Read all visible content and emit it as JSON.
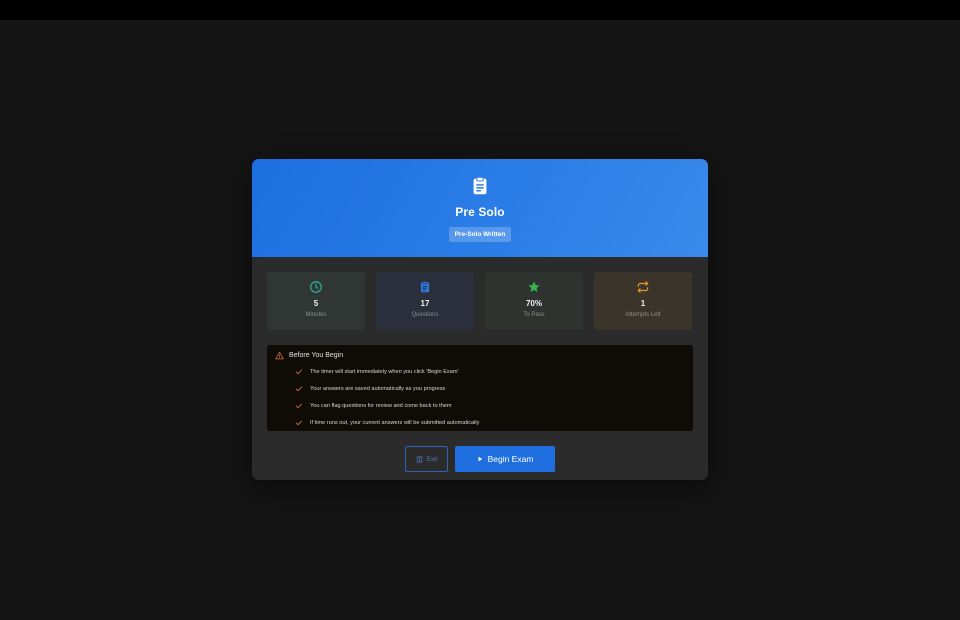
{
  "exam": {
    "title": "Pre Solo",
    "badge": "Pre-Solo Written",
    "icon": "clipboard-icon"
  },
  "stats": [
    {
      "value": "5",
      "label": "Minutes",
      "icon": "clock-icon",
      "color": "#2bb3a0"
    },
    {
      "value": "17",
      "label": "Questions",
      "icon": "clipboard-icon",
      "color": "#2d7be6"
    },
    {
      "value": "70%",
      "label": "To Pass",
      "icon": "star-icon",
      "color": "#37b24d"
    },
    {
      "value": "1",
      "label": "Attempts Left",
      "icon": "repeat-icon",
      "color": "#e89a2a"
    }
  ],
  "notice": {
    "title": "Before You Begin",
    "icon": "warning-icon",
    "items": [
      "The timer will start immediately when you click 'Begin Exam'",
      "Your answers are saved automatically as you progress",
      "You can flag questions for review and come back to them",
      "If time runs out, your current answers will be submitted automatically"
    ]
  },
  "actions": {
    "exit_label": "Exit",
    "begin_label": "Begin Exam"
  },
  "colors": {
    "accent": "#1f6fe0",
    "check": "#e0763a",
    "warning": "#e0763a"
  }
}
